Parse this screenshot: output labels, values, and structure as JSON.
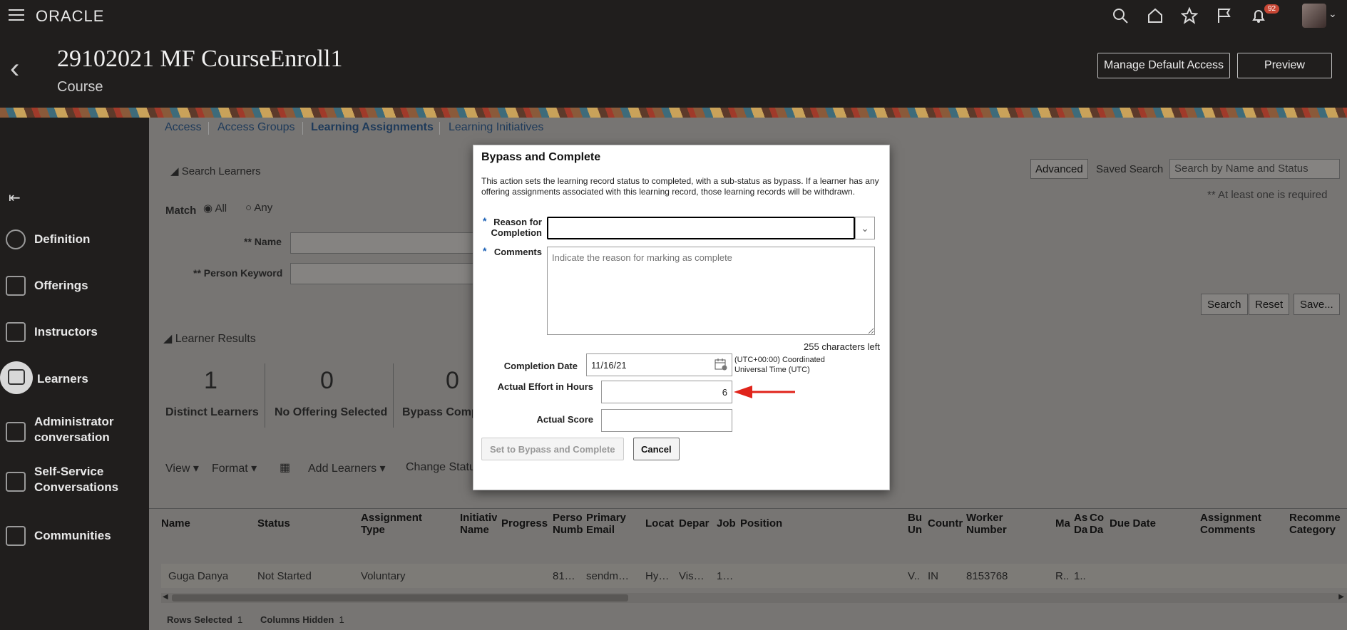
{
  "topbar": {
    "logo": "ORACLE",
    "notification_count": "92",
    "icons": [
      "search-icon",
      "home-icon",
      "star-icon",
      "flag-icon",
      "bell-icon"
    ]
  },
  "header": {
    "title": "29102021 MF CourseEnroll1",
    "subtitle": "Course",
    "manage_access_label": "Manage Default Access",
    "preview_label": "Preview"
  },
  "sidebar": {
    "items": [
      {
        "label": "Definition",
        "icon": "gears-icon"
      },
      {
        "label": "Offerings",
        "icon": "books-icon"
      },
      {
        "label": "Instructors",
        "icon": "list-icon"
      },
      {
        "label": "Learners",
        "icon": "learner-icon"
      },
      {
        "label": "Administrator conversation",
        "icon": "chat-icon"
      },
      {
        "label": "Self-Service Conversations",
        "icon": "chat-icon"
      },
      {
        "label": "Communities",
        "icon": "books-icon"
      }
    ]
  },
  "tabs": [
    "Access",
    "Access Groups",
    "Learning Assignments",
    "Learning Initiatives"
  ],
  "search": {
    "section_label": "Search Learners",
    "match_label": "Match",
    "match_all": "All",
    "match_any": "Any",
    "name_label": "Name",
    "keyword_label": "Person Keyword",
    "req_marker": "**",
    "advanced_label": "Advanced",
    "saved_search_label": "Saved Search",
    "saved_search_placeholder": "Search by Name and Status",
    "at_least_one": "** At least one is required",
    "search_btn": "Search",
    "reset_btn": "Reset",
    "save_btn": "Save..."
  },
  "results": {
    "section_label": "Learner Results",
    "metrics": [
      {
        "value": "1",
        "label": "Distinct Learners"
      },
      {
        "value": "0",
        "label": "No Offering Selected"
      },
      {
        "value": "0",
        "label": "Bypass Comp"
      }
    ]
  },
  "toolbar": {
    "view": "View",
    "format": "Format",
    "add_learners": "Add Learners",
    "change_status": "Change Statu"
  },
  "table": {
    "headers": [
      "Name",
      "Status",
      "Assignment Type",
      "Initiativ Name",
      "Progress",
      "Perso Numb",
      "Primary Email",
      "Locat",
      "Depar",
      "Job",
      "Position",
      "Bu Un",
      "Countr",
      "Worker Number",
      "Ma",
      "As Da",
      "Co Da",
      "Due Date",
      "Assignment Comments",
      "Recomme Category"
    ],
    "row": [
      "Guga Danya",
      "Not Started",
      "Voluntary",
      "81…",
      "sendm…",
      "Hy…",
      "Vis…",
      "1…",
      "V..",
      "IN",
      "8153768",
      "R..",
      "1.."
    ]
  },
  "footer": {
    "rows_selected_label": "Rows Selected",
    "rows_selected": "1",
    "columns_hidden_label": "Columns Hidden",
    "columns_hidden": "1"
  },
  "dialog": {
    "title": "Bypass and Complete",
    "description": "This action sets the learning record status to completed, with a sub-status as bypass. If a learner has any offering assignments associated with this learning record, those learning records will be withdrawn.",
    "reason_label": "Reason for Completion",
    "comments_label": "Comments",
    "comments_placeholder": "Indicate the reason for marking as complete",
    "chars_left": "255  characters left",
    "completion_date_label": "Completion Date",
    "completion_date": "11/16/21",
    "timezone": "(UTC+00:00) Coordinated Universal Time (UTC)",
    "effort_label": "Actual Effort in Hours",
    "effort_value": "6",
    "score_label": "Actual Score",
    "bypass_btn": "Set to Bypass and Complete",
    "cancel_btn": "Cancel",
    "required_marker": "*"
  },
  "colors": {
    "topbar_bg": "#201e1d",
    "accent_red": "#c74634",
    "link_blue": "#1e3a5a",
    "arrow_red": "#e0241b"
  }
}
